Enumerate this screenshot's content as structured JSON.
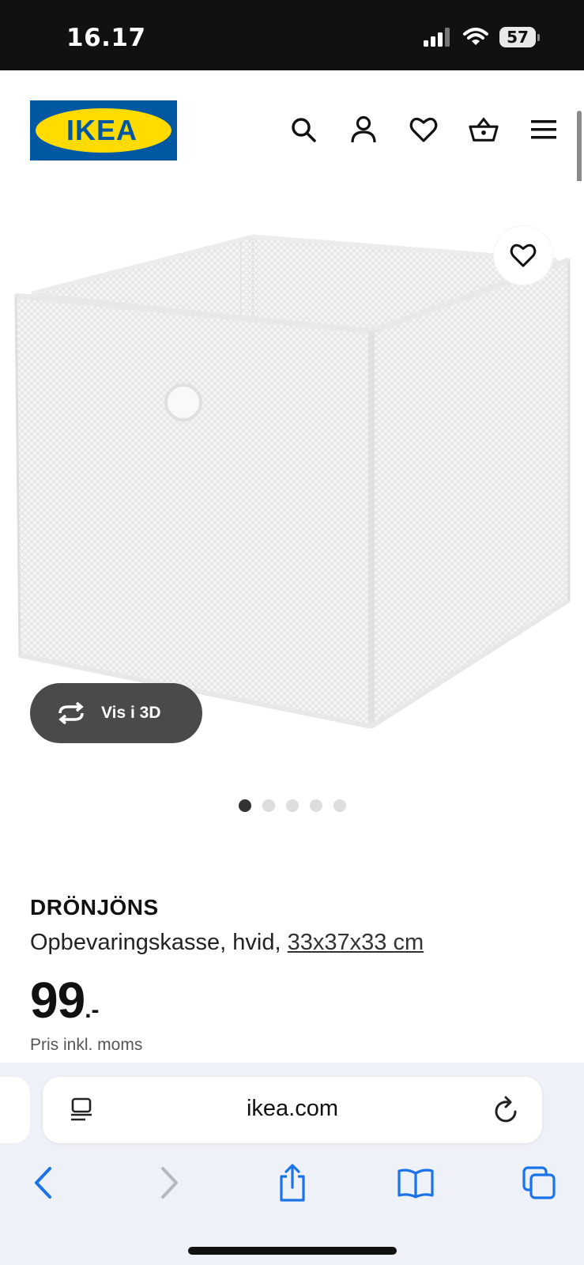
{
  "status_bar": {
    "time": "16.17",
    "battery": "57"
  },
  "brand": {
    "logo_text": "IKEA",
    "logo_blue": "#0058A3",
    "logo_yellow": "#FFDB00"
  },
  "header": {
    "icons": [
      "search-icon",
      "account-icon",
      "heart-icon",
      "basket-icon",
      "menu-icon"
    ]
  },
  "gallery": {
    "view_3d_label": "Vis i 3D",
    "image_count": 5,
    "active_index": 0
  },
  "product": {
    "name": "DRÖNJÖNS",
    "description": "Opbevaringskasse, hvid,",
    "dimensions": "33x37x33 cm",
    "price": "99",
    "price_suffix": ".-",
    "price_note": "Pris inkl. moms"
  },
  "browser": {
    "url": "ikea.com"
  }
}
